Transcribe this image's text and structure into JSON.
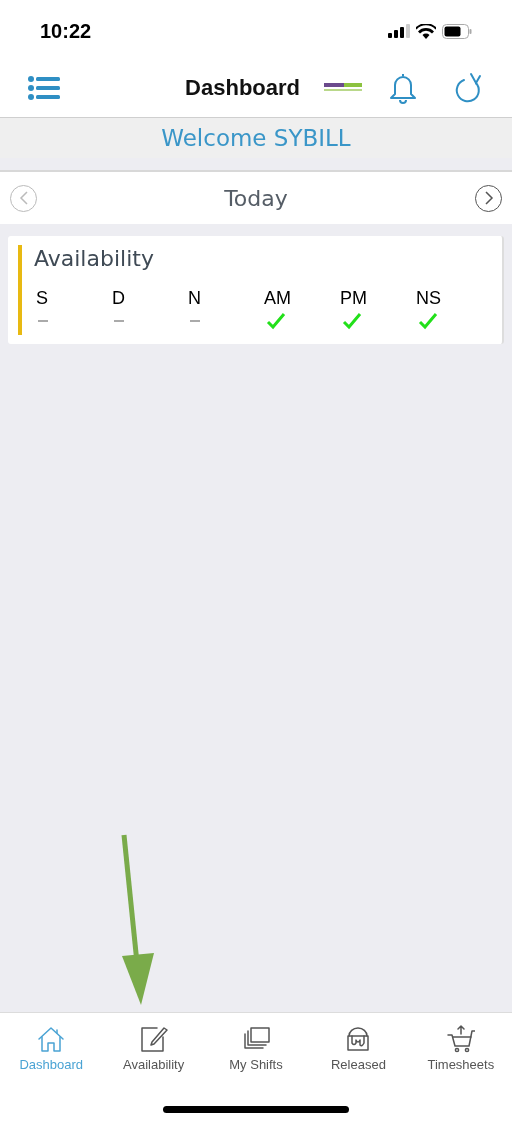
{
  "status_bar": {
    "time": "10:22"
  },
  "header": {
    "title": "Dashboard"
  },
  "welcome": "Welcome SYBILL",
  "date_nav": {
    "label": "Today"
  },
  "availability": {
    "title": "Availability",
    "columns": [
      {
        "label": "S",
        "available": false
      },
      {
        "label": "D",
        "available": false
      },
      {
        "label": "N",
        "available": false
      },
      {
        "label": "AM",
        "available": true
      },
      {
        "label": "PM",
        "available": true
      },
      {
        "label": "NS",
        "available": true
      }
    ]
  },
  "tabs": [
    {
      "label": "Dashboard",
      "kind": "home",
      "selected": true
    },
    {
      "label": "Availability",
      "kind": "edit",
      "selected": false
    },
    {
      "label": "My Shifts",
      "kind": "stack",
      "selected": false
    },
    {
      "label": "Released",
      "kind": "bucket",
      "selected": false
    },
    {
      "label": "Timesheets",
      "kind": "cart",
      "selected": false
    }
  ]
}
